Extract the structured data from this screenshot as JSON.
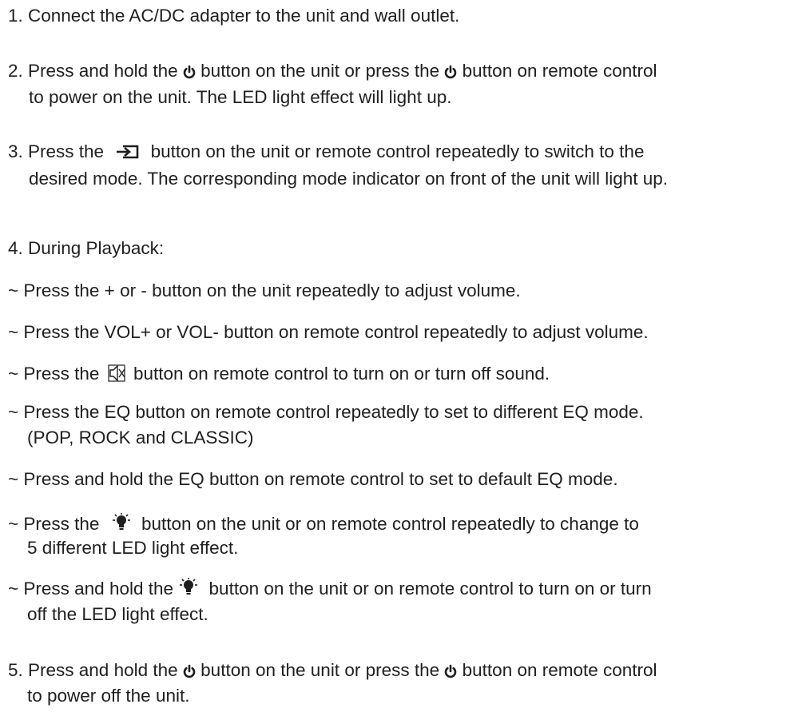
{
  "steps": [
    {
      "id": "step1",
      "text": "1. Connect the AC/DC adapter to the unit and wall outlet."
    },
    {
      "id": "step2",
      "l1a": "2. Press and hold the",
      "l1b": "button on the unit or press the",
      "l1c": "button on remote control",
      "l2": "to power on the unit. The LED light effect will light up.",
      "icon": "power-icon"
    },
    {
      "id": "step3",
      "l1a": "3. Press the",
      "l1b": "button on the unit or remote control repeatedly to switch to the",
      "l2": "desired mode. The corresponding mode indicator on front of the unit will light up.",
      "icon": "input-source-icon"
    },
    {
      "id": "step4",
      "heading": "4. During Playback:",
      "bullets": {
        "b1": "~ Press the + or - button on the unit repeatedly to adjust volume.",
        "b2": "~ Press the VOL+ or VOL- button on remote control repeatedly to adjust volume.",
        "b3a": "~ Press the",
        "b3b": "button on remote control to turn on or turn off sound.",
        "b4l1": "~ Press the EQ button on remote control repeatedly to set to different EQ mode.",
        "b4l2": "(POP, ROCK and CLASSIC)",
        "b5": "~ Press and hold the EQ button on remote control to set to default EQ mode.",
        "b6a": "~ Press the",
        "b6b": "button on the unit or on remote control repeatedly to change to",
        "b6l2": "5 different LED light effect.",
        "b7a": "~ Press and hold  the",
        "b7b": "button on the unit or on remote control to turn on or turn",
        "b7l2": "off the LED light effect."
      }
    },
    {
      "id": "step5",
      "l1a": "5. Press and hold the",
      "l1b": "button on the unit or press the",
      "l1c": "button on remote control",
      "l2": "to power off the unit."
    }
  ],
  "icons": [
    "power-icon",
    "input-source-icon",
    "mute-icon",
    "led-light-icon"
  ]
}
